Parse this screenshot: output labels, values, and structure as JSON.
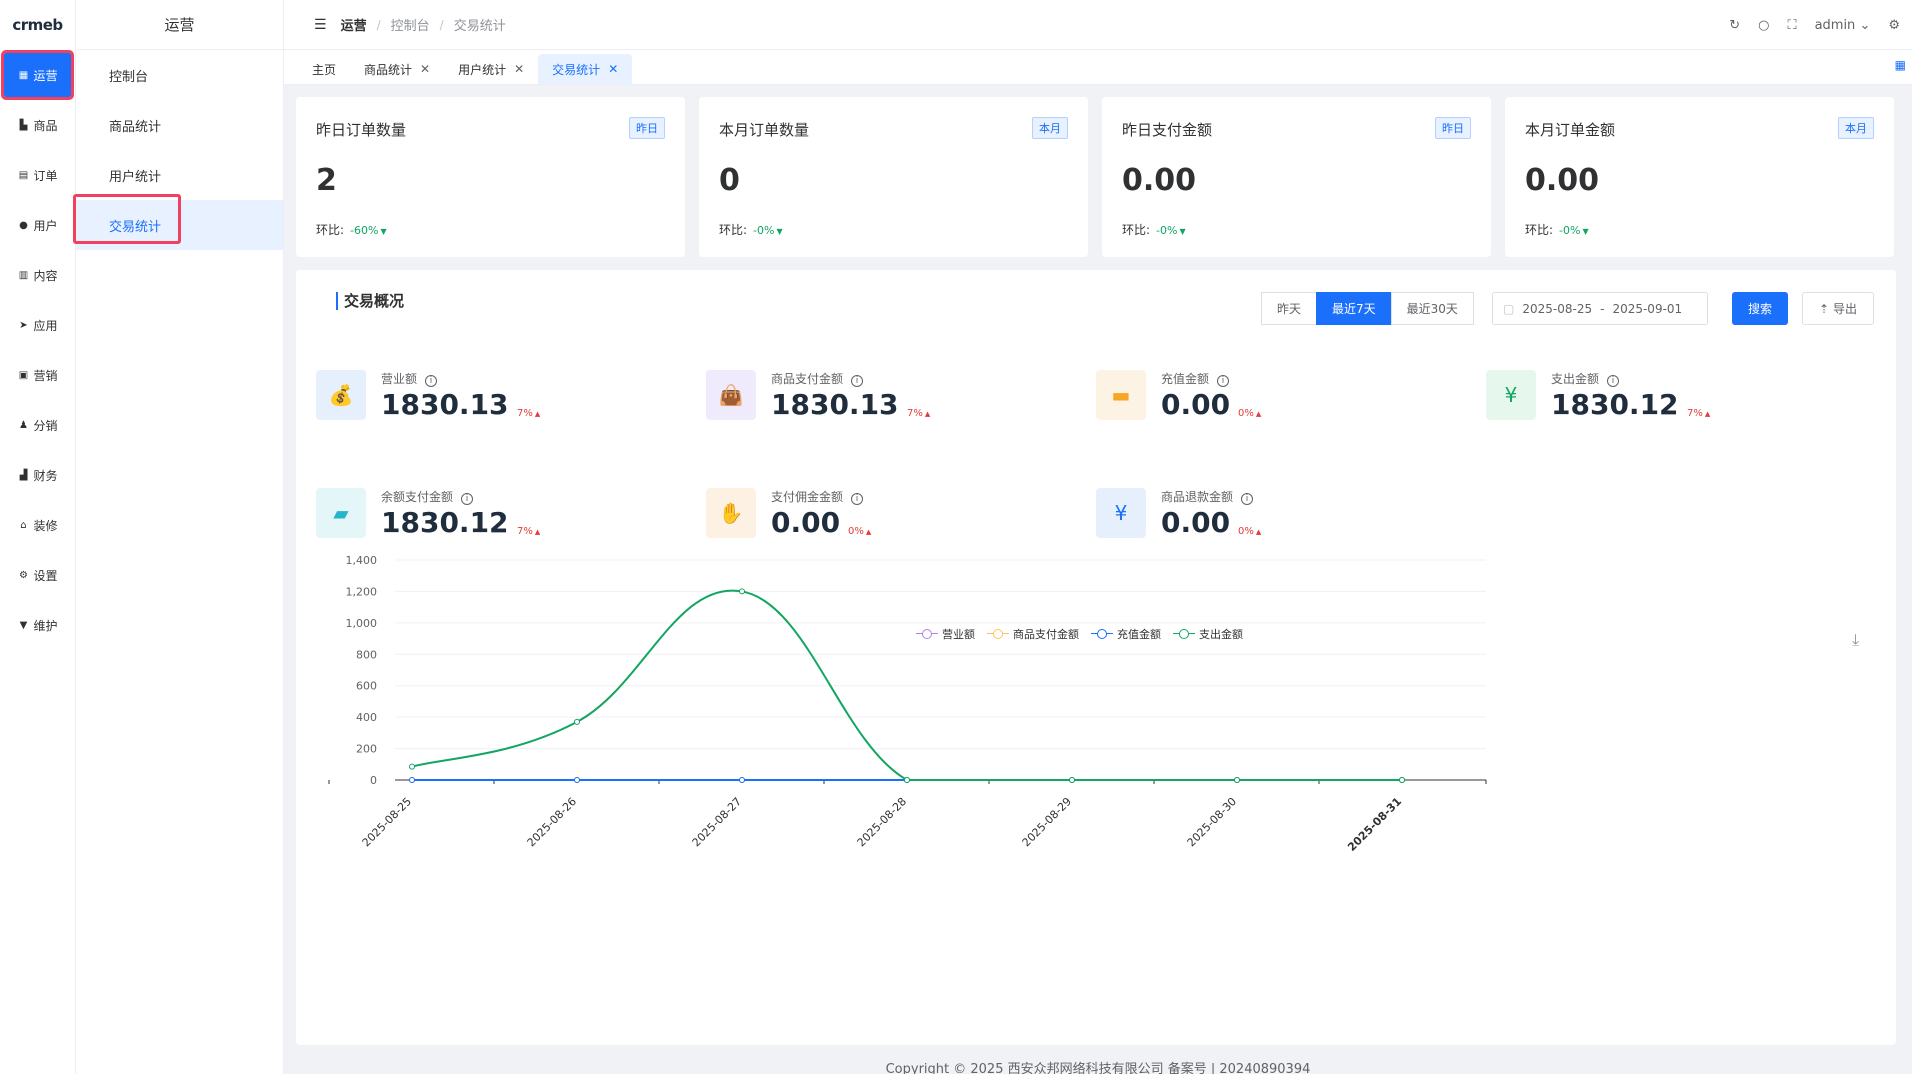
{
  "app": {
    "logo": "crmeb"
  },
  "rail": {
    "items": [
      {
        "icon": "grid-icon",
        "glyph": "▦",
        "label": "运营",
        "active": true
      },
      {
        "icon": "bag-icon",
        "glyph": "▙",
        "label": "商品"
      },
      {
        "icon": "clipboard-icon",
        "glyph": "▤",
        "label": "订单"
      },
      {
        "icon": "user-icon",
        "glyph": "●",
        "label": "用户"
      },
      {
        "icon": "bar-chart-icon",
        "glyph": "▥",
        "label": "内容"
      },
      {
        "icon": "send-icon",
        "glyph": "➤",
        "label": "应用"
      },
      {
        "icon": "marketing-icon",
        "glyph": "▣",
        "label": "营销"
      },
      {
        "icon": "user-share-icon",
        "glyph": "♟",
        "label": "分销"
      },
      {
        "icon": "finance-icon",
        "glyph": "▟",
        "label": "财务"
      },
      {
        "icon": "home-icon",
        "glyph": "⌂",
        "label": "装修"
      },
      {
        "icon": "gear-icon",
        "glyph": "⚙",
        "label": "设置"
      },
      {
        "icon": "tool-icon",
        "glyph": "▼",
        "label": "维护"
      }
    ]
  },
  "subnav": {
    "title": "运营",
    "items": [
      {
        "label": "控制台"
      },
      {
        "label": "商品统计"
      },
      {
        "label": "用户统计"
      },
      {
        "label": "交易统计",
        "active": true
      }
    ]
  },
  "header": {
    "breadcrumb": [
      "运营",
      "控制台",
      "交易统计"
    ],
    "user": "admin"
  },
  "tabs": [
    {
      "label": "主页",
      "closable": false
    },
    {
      "label": "商品统计",
      "closable": true
    },
    {
      "label": "用户统计",
      "closable": true
    },
    {
      "label": "交易统计",
      "closable": true,
      "active": true
    }
  ],
  "cards": [
    {
      "title": "昨日订单数量",
      "badge": "昨日",
      "value": "2",
      "ratio_label": "环比:",
      "ratio": "-60%"
    },
    {
      "title": "本月订单数量",
      "badge": "本月",
      "value": "0",
      "ratio_label": "环比:",
      "ratio": "-0%"
    },
    {
      "title": "昨日支付金额",
      "badge": "昨日",
      "value": "0.00",
      "ratio_label": "环比:",
      "ratio": "-0%"
    },
    {
      "title": "本月订单金额",
      "badge": "本月",
      "value": "0.00",
      "ratio_label": "环比:",
      "ratio": "-0%"
    }
  ],
  "overview": {
    "title": "交易概况",
    "ranges": [
      {
        "label": "昨天"
      },
      {
        "label": "最近7天",
        "active": true
      },
      {
        "label": "最近30天"
      }
    ],
    "date_start": "2025-08-25",
    "date_sep": "-",
    "date_end": "2025-09-01",
    "search_label": "搜索",
    "export_label": "导出",
    "metrics": [
      {
        "label": "营业额",
        "value": "1830.13",
        "pct": "7%",
        "icon": "money-bag-icon",
        "glyph": "💰",
        "bg": "#e6f0fc",
        "fg": "#1a6ffb"
      },
      {
        "label": "商品支付金额",
        "value": "1830.13",
        "pct": "7%",
        "icon": "shopping-bag-icon",
        "glyph": "👜",
        "bg": "#f0ebfc",
        "fg": "#8b5cf6"
      },
      {
        "label": "充值金额",
        "value": "0.00",
        "pct": "0%",
        "icon": "card-icon",
        "glyph": "▬",
        "bg": "#fdf3e4",
        "fg": "#f5a623"
      },
      {
        "label": "支出金额",
        "value": "1830.12",
        "pct": "7%",
        "icon": "money-out-icon",
        "glyph": "¥",
        "bg": "#e6f7ee",
        "fg": "#13a562"
      },
      {
        "label": "余额支付金额",
        "value": "1830.12",
        "pct": "7%",
        "icon": "wallet-icon",
        "glyph": "▰",
        "bg": "#e4f6f8",
        "fg": "#26b6c9"
      },
      {
        "label": "支付佣金金额",
        "value": "0.00",
        "pct": "0%",
        "icon": "commission-icon",
        "glyph": "✋",
        "bg": "#fdf1e4",
        "fg": "#f5a623"
      },
      {
        "label": "商品退款金额",
        "value": "0.00",
        "pct": "0%",
        "icon": "refund-icon",
        "glyph": "¥",
        "bg": "#e6f0fc",
        "fg": "#1a6ffb"
      }
    ]
  },
  "chart_data": {
    "type": "line",
    "title": "",
    "xlabel": "",
    "ylabel": "",
    "x": [
      "2025-08-25",
      "2025-08-26",
      "2025-08-27",
      "2025-08-28",
      "2025-08-29",
      "2025-08-30",
      "2025-08-31"
    ],
    "ylim": [
      0,
      1400
    ],
    "yticks": [
      "0",
      "200",
      "400",
      "600",
      "800",
      "1,000",
      "1,200",
      "1,400"
    ],
    "grid": true,
    "legend_position": "top-center",
    "series": [
      {
        "name": "营业额",
        "color": "#b37feb",
        "values": [
          0,
          0,
          0,
          0,
          0,
          0,
          0
        ]
      },
      {
        "name": "商品支付金额",
        "color": "#fcc35c",
        "values": [
          0,
          0,
          0,
          0,
          0,
          0,
          0
        ]
      },
      {
        "name": "充值金额",
        "color": "#1a6ffb",
        "values": [
          0,
          0,
          0,
          0,
          0,
          0,
          0
        ]
      },
      {
        "name": "支出金额",
        "color": "#13a562",
        "values": [
          85,
          370,
          1200,
          0,
          0,
          0,
          0
        ]
      }
    ]
  },
  "footer": {
    "text": "Copyright © 2025 西安众邦网络科技有限公司 备案号 | 20240890394"
  }
}
